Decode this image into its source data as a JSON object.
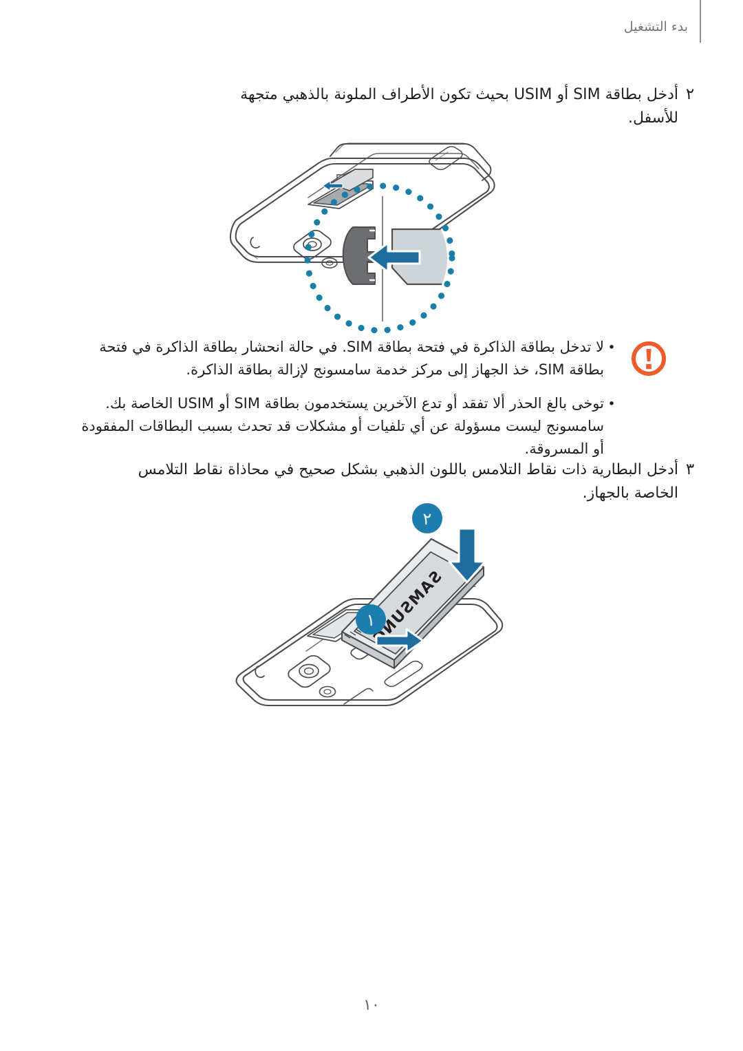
{
  "header": {
    "title": "بدء التشغيل"
  },
  "steps": [
    {
      "number": "٢",
      "text": "أدخل بطاقة SIM أو USIM بحيث تكون الأطراف الملونة بالذهبي متجهة للأسفل."
    },
    {
      "number": "٣",
      "text": "أدخل البطارية ذات نقاط التلامس باللون الذهبي بشكل صحيح في محاذاة نقاط التلامس الخاصة بالجهاز."
    }
  ],
  "note": {
    "icon_name": "warning-icon",
    "icon_color": "#EF5B2B",
    "bullet": "•",
    "items": [
      "لا تدخل بطاقة الذاكرة في فتحة بطاقة SIM. في حالة انحشار بطاقة الذاكرة في فتحة بطاقة SIM، خذ الجهاز إلى مركز خدمة سامسونج لإزالة بطاقة الذاكرة.",
      "توخى بالغ الحذر ألا تفقد أو تدع الآخرين يستخدمون بطاقة SIM أو USIM الخاصة بك. سامسونج ليست مسؤولة عن أي تلفيات أو مشكلات قد تحدث بسبب البطاقات المفقودة أو المسروقة."
    ]
  },
  "figures": [
    {
      "name": "sim-insert-illustration",
      "caption": "",
      "callout_color": "#1A7FA8",
      "arrow_color": "#1D6E9E",
      "device_label": ""
    },
    {
      "name": "battery-insert-illustration",
      "caption": "",
      "badges": [
        {
          "label": "٢",
          "color": "#1B7EAF"
        },
        {
          "label": "١",
          "color": "#1B7EAF"
        }
      ],
      "battery_brand": "SAMSUNG",
      "arrow_color": "#1D6E9E"
    }
  ],
  "footer": {
    "page_number": "١٠"
  }
}
